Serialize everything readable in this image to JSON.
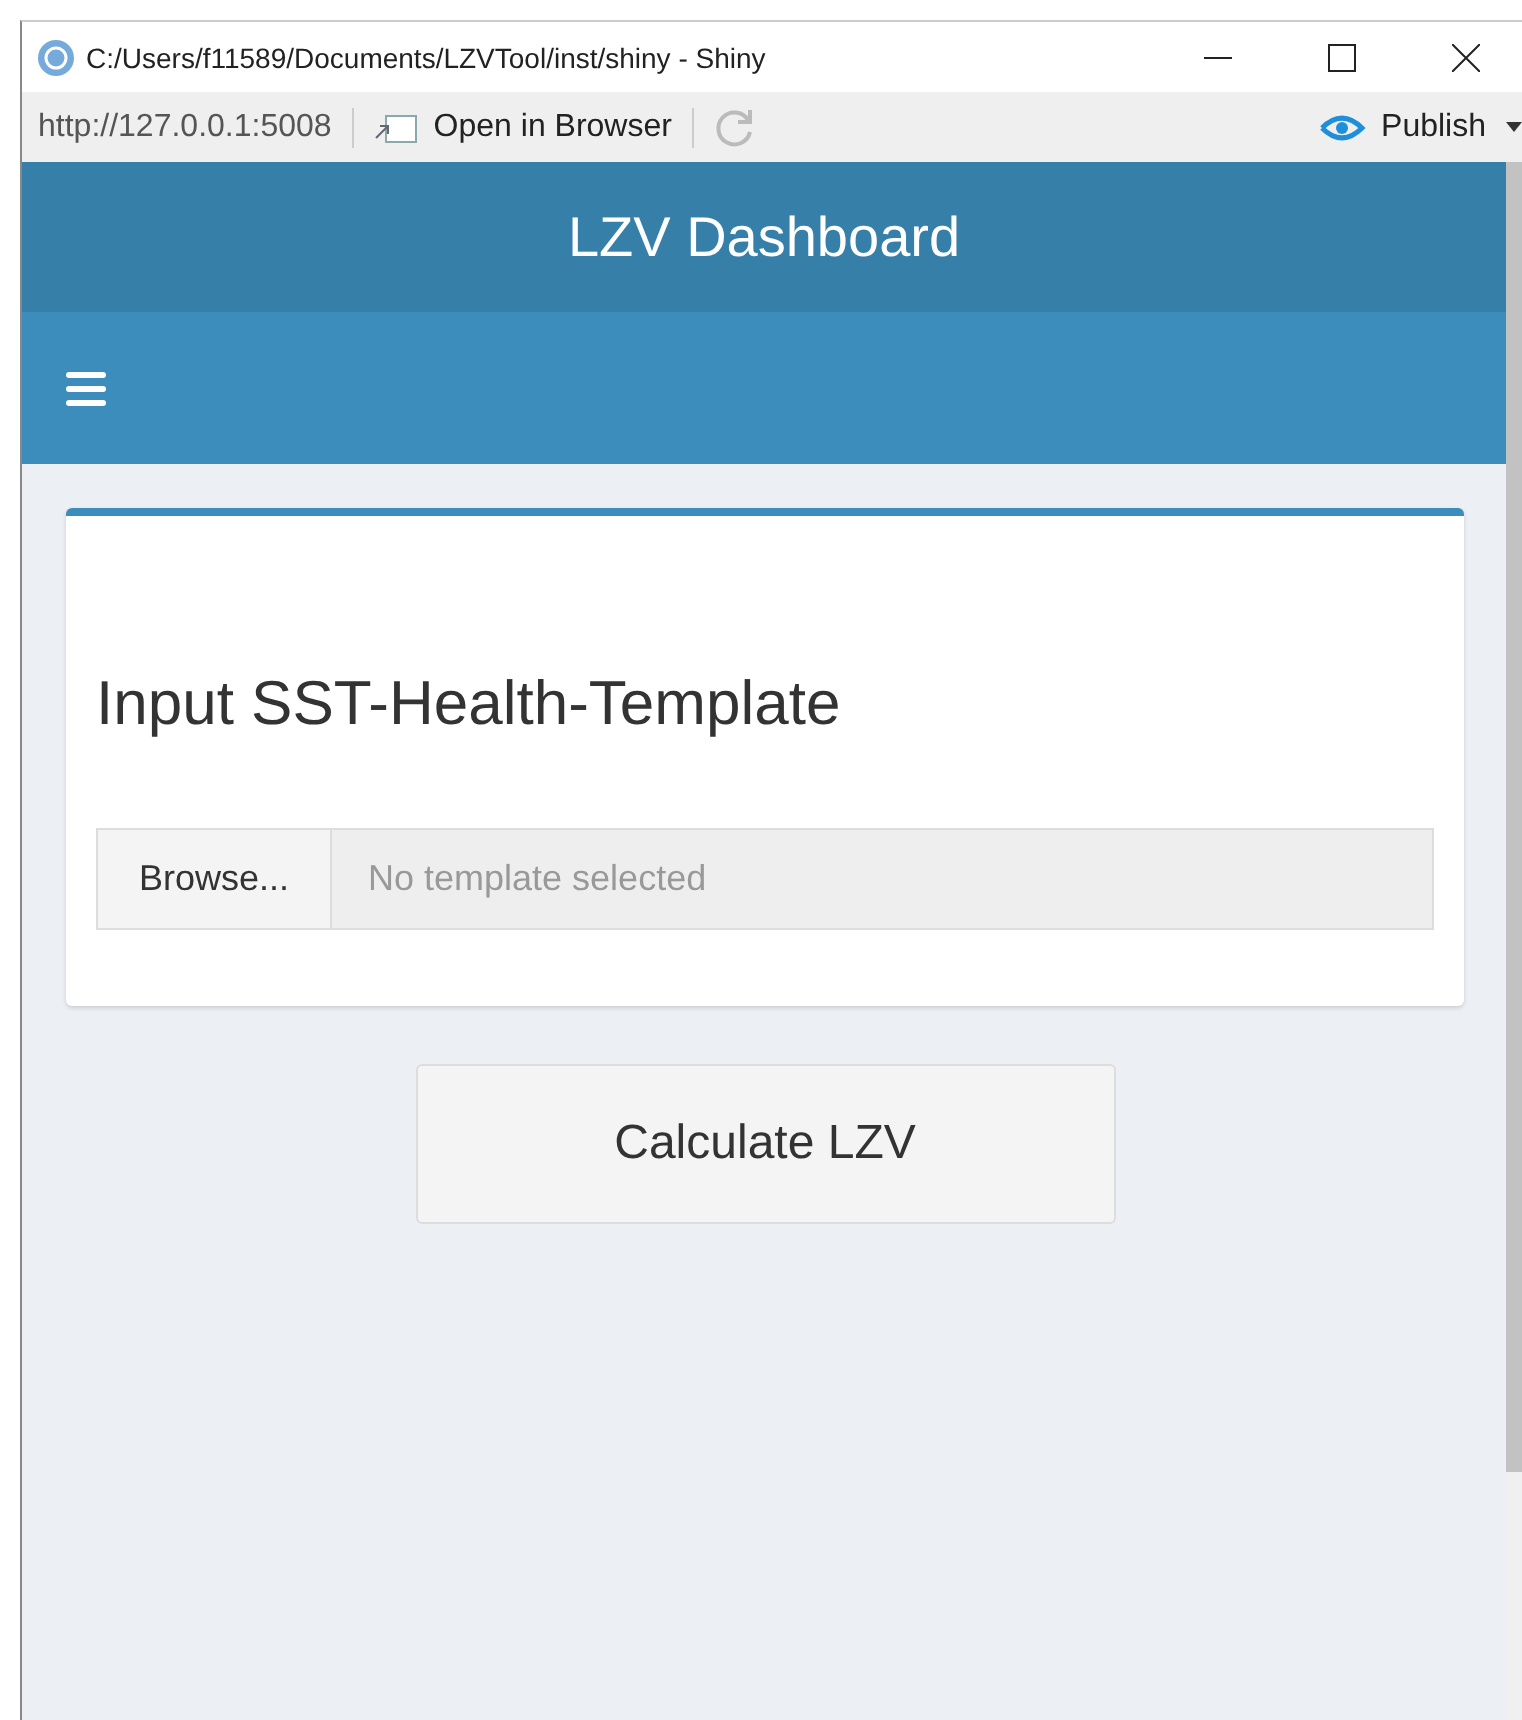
{
  "window": {
    "title": "C:/Users/f11589/Documents/LZVTool/inst/shiny - Shiny"
  },
  "toolbar": {
    "url": "http://127.0.0.1:5008",
    "open_in_browser": "Open in Browser",
    "publish": "Publish"
  },
  "header": {
    "title": "LZV Dashboard"
  },
  "card": {
    "title": "Input SST-Health-Template",
    "browse": "Browse...",
    "placeholder": "No template selected"
  },
  "action_button": "Calculate LZV"
}
